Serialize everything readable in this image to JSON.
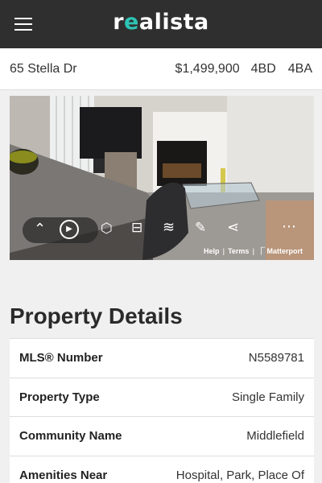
{
  "header": {
    "logo_prefix": "r",
    "logo_accent": "e",
    "logo_suffix": "alista",
    "accent_color": "#2ec4b6"
  },
  "listing": {
    "address": "65 Stella Dr",
    "price": "$1,499,900",
    "beds": "4BD",
    "baths": "4BA"
  },
  "tour": {
    "help_label": "Help",
    "terms_label": "Terms",
    "brand_label": "Matterport"
  },
  "details": {
    "title": "Property Details",
    "rows": [
      {
        "key": "MLS® Number",
        "value": "N5589781"
      },
      {
        "key": "Property Type",
        "value": "Single Family"
      },
      {
        "key": "Community Name",
        "value": "Middlefield"
      },
      {
        "key": "Amenities Near",
        "value": "Hospital, Park, Place Of"
      }
    ]
  }
}
